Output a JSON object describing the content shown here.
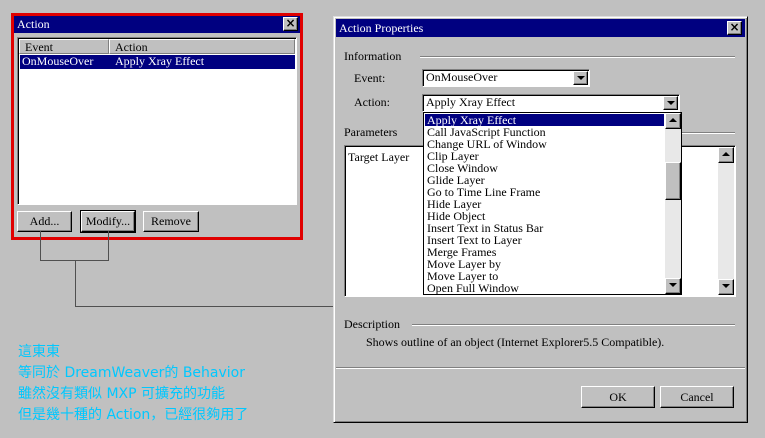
{
  "action_panel": {
    "title": "Action",
    "columns": [
      "Event",
      "Action"
    ],
    "rows": [
      {
        "event": "OnMouseOver",
        "action": "Apply Xray Effect",
        "selected": true
      }
    ],
    "buttons": {
      "add": "Add...",
      "modify": "Modify...",
      "remove": "Remove"
    },
    "close_glyph": "×"
  },
  "dialog": {
    "title": "Action Properties",
    "close_glyph": "×",
    "information_label": "Information",
    "event_label": "Event:",
    "event_value": "OnMouseOver",
    "action_label": "Action:",
    "action_value": "Apply Xray Effect",
    "parameters_label": "Parameters",
    "param_column": "Target Layer",
    "description_label": "Description",
    "description_text": "Shows outline of an object (Internet Explorer5.5 Compatible).",
    "ok_label": "OK",
    "cancel_label": "Cancel",
    "action_options": [
      "Apply Xray Effect",
      "Call JavaScript Function",
      "Change URL of Window",
      "Clip Layer",
      "Close Window",
      "Glide Layer",
      "Go to Time Line Frame",
      "Hide Layer",
      "Hide Object",
      "Insert Text in Status Bar",
      "Insert Text to Layer",
      "Merge Frames",
      "Move Layer by",
      "Move Layer to",
      "Open Full Window"
    ],
    "selected_option_index": 0
  },
  "caption": {
    "line1": "這東東",
    "line2": "等同於 DreamWeaver的 Behavior",
    "line3": "雖然沒有類似 MXP 可擴充的功能",
    "line4": "但是幾十種的 Action，已經很夠用了"
  },
  "colors": {
    "title_bar": "#000080",
    "highlight_frame": "#e00000",
    "caption_text": "#00c8ff",
    "window_face": "#c0c0c0"
  }
}
